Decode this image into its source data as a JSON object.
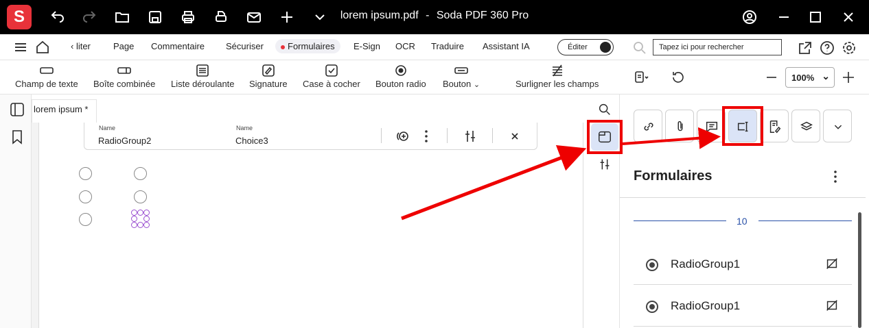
{
  "app": {
    "title_file": "lorem ipsum.pdf",
    "title_sep": "-",
    "title_app": "Soda PDF 360 Pro",
    "logo": "S"
  },
  "menu": {
    "items": [
      "‹ liter",
      "Page",
      "Commentaire",
      "Sécuriser",
      "Formulaires",
      "E-Sign",
      "OCR",
      "Traduire",
      "Assistant IA"
    ],
    "active": "Formulaires",
    "edit_toggle": "Éditer",
    "search_placeholder": "Tapez ici pour rechercher"
  },
  "toolbar": {
    "tools": [
      "Champ de texte",
      "Boîte combinée",
      "Liste déroulante",
      "Signature",
      "Case à cocher",
      "Bouton radio",
      "Bouton",
      "Surligner les champs"
    ],
    "zoom": "100%"
  },
  "document": {
    "tab": "lorem ipsum *",
    "field_name_label": "Name",
    "field_group": "RadioGroup2",
    "field_choice_label": "Name",
    "field_choice": "Choice3"
  },
  "panel": {
    "title": "Formulaires",
    "count": "10",
    "items": [
      "RadioGroup1",
      "RadioGroup1"
    ]
  },
  "colors": {
    "brand": "#e8323a",
    "highlight": "#e00000",
    "accent_blue": "#2950a8"
  }
}
